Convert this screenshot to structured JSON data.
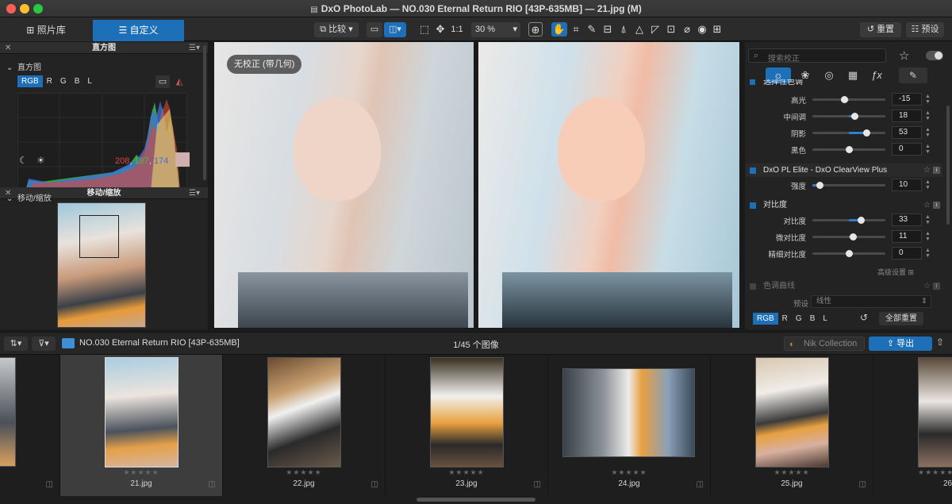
{
  "window": {
    "title": "DxO PhotoLab — NO.030 Eternal Return RIO [43P-635MB] — 21.jpg (M)"
  },
  "tabs": {
    "library": "照片库",
    "customize": "自定义"
  },
  "toolbar": {
    "compare": "比较",
    "one_to_one": "1:1",
    "zoom": "30 %",
    "reset": "重置",
    "preset": "预设"
  },
  "left": {
    "histogram_panel": "直方图",
    "histogram_sub": "直方图",
    "channels": [
      "RGB",
      "R",
      "G",
      "B",
      "L"
    ],
    "rgb": {
      "r": "208",
      "g": "187",
      "b": "174"
    },
    "nav_panel": "移动/缩放",
    "nav_sub": "移动/缩放"
  },
  "viewer": {
    "badge": "无校正 (带几何)"
  },
  "right": {
    "search_placeholder": "搜索校正",
    "section_selective": "选择性色调",
    "sliders1": [
      {
        "label": "高光",
        "value": "-15",
        "pct": 0.43
      },
      {
        "label": "中间调",
        "value": "18",
        "pct": 0.58
      },
      {
        "label": "阴影",
        "value": "53",
        "pct": 0.74
      },
      {
        "label": "黑色",
        "value": "0",
        "pct": 0.5
      }
    ],
    "plugin": "DxO PL Elite - DxO ClearView Plus",
    "strength": {
      "label": "强度",
      "value": "10",
      "pct": 0.1
    },
    "section_contrast": "对比度",
    "sliders2": [
      {
        "label": "对比度",
        "value": "33",
        "pct": 0.66
      },
      {
        "label": "微对比度",
        "value": "11",
        "pct": 0.55
      },
      {
        "label": "精细对比度",
        "value": "0",
        "pct": 0.5
      }
    ],
    "advanced": "高级设置",
    "section_curve": "色调曲线",
    "preset_label": "预设",
    "preset_value": "线性",
    "curve_channels": [
      "RGB",
      "R",
      "G",
      "B",
      "L"
    ],
    "reset_all": "全部重置"
  },
  "filmstrip": {
    "folder": "NO.030 Eternal Return RIO [43P-635MB]",
    "count": "1/45 个图像",
    "nik": "Nik Collection",
    "export": "导出",
    "items": [
      {
        "name": "21.jpg"
      },
      {
        "name": "22.jpg"
      },
      {
        "name": "23.jpg"
      },
      {
        "name": "24.jpg"
      },
      {
        "name": "25.jpg"
      },
      {
        "name": "26"
      }
    ],
    "stars": "★★★★★"
  },
  "colors": {
    "accent": "#1d6fb8",
    "hist_r": "#e0453a",
    "hist_g": "#3ec04a",
    "hist_b": "#3f6fe0"
  }
}
